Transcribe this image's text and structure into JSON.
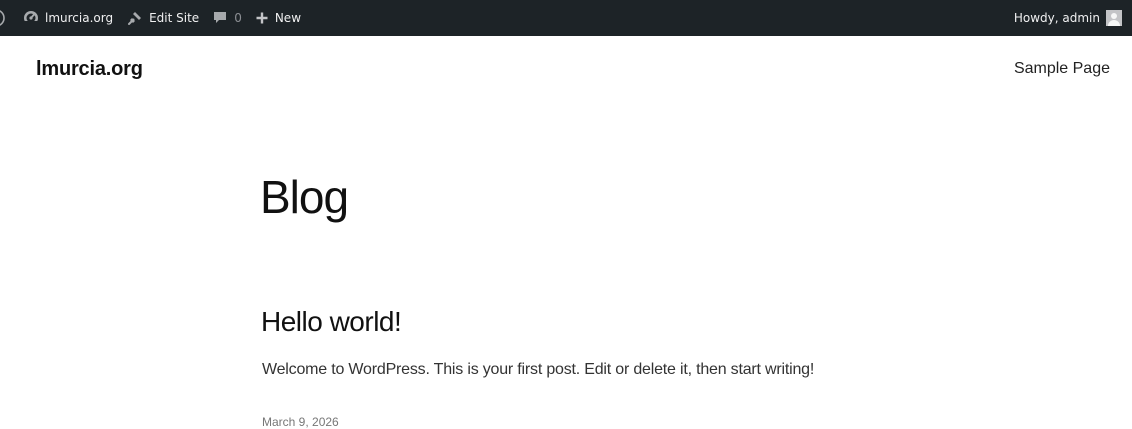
{
  "admin_bar": {
    "site_name": "lmurcia.org",
    "edit_site_label": "Edit Site",
    "comments_count": "0",
    "new_label": "New",
    "greeting": "Howdy, admin",
    "icons": [
      "wordpress-logo-icon",
      "dashboard-icon",
      "edit-site-icon",
      "comment-icon",
      "plus-icon",
      "avatar"
    ]
  },
  "header": {
    "site_title": "lmurcia.org",
    "nav": [
      {
        "label": "Sample Page"
      }
    ]
  },
  "main": {
    "page_title": "Blog",
    "posts": [
      {
        "title": "Hello world!",
        "excerpt": "Welcome to WordPress. This is your first post. Edit or delete it, then start writing!",
        "date": "March 9, 2026"
      }
    ]
  },
  "colors": {
    "admin_bar_bg": "#1d2327",
    "admin_bar_text": "#f0f0f1",
    "page_bg": "#ffffff",
    "text": "#111111"
  }
}
